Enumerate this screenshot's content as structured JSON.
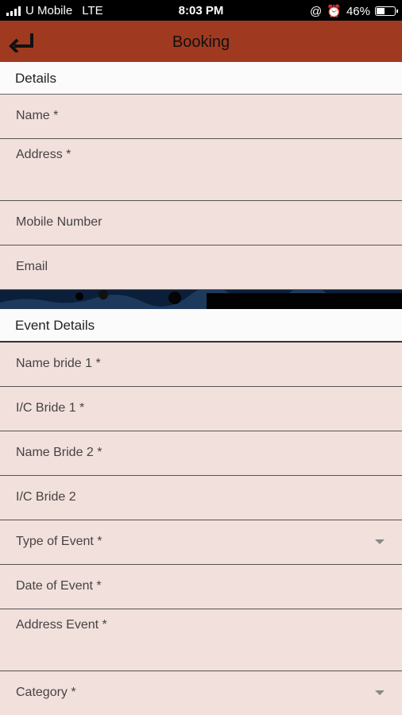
{
  "status_bar": {
    "carrier": "U Mobile",
    "network": "LTE",
    "time": "8:03 PM",
    "battery": "46%"
  },
  "header": {
    "title": "Booking",
    "back_icon": "back-arrow-icon"
  },
  "details": {
    "title": "Details",
    "fields": {
      "name": "Name *",
      "address": "Address *",
      "mobile": "Mobile Number",
      "email": "Email"
    }
  },
  "event_details": {
    "title": "Event Details",
    "fields": {
      "name_bride_1": "Name bride 1 *",
      "ic_bride_1": "I/C Bride 1 *",
      "name_bride_2": "Name Bride 2 *",
      "ic_bride_2": "I/C Bride 2",
      "type_of_event": "Type of Event *",
      "date_of_event": "Date of Event *",
      "address_event": "Address Event *",
      "category": "Category *"
    }
  },
  "colors": {
    "header": "#9f3a20",
    "field_bg": "#f2e0dc",
    "section_bg": "#fbfbfb"
  }
}
